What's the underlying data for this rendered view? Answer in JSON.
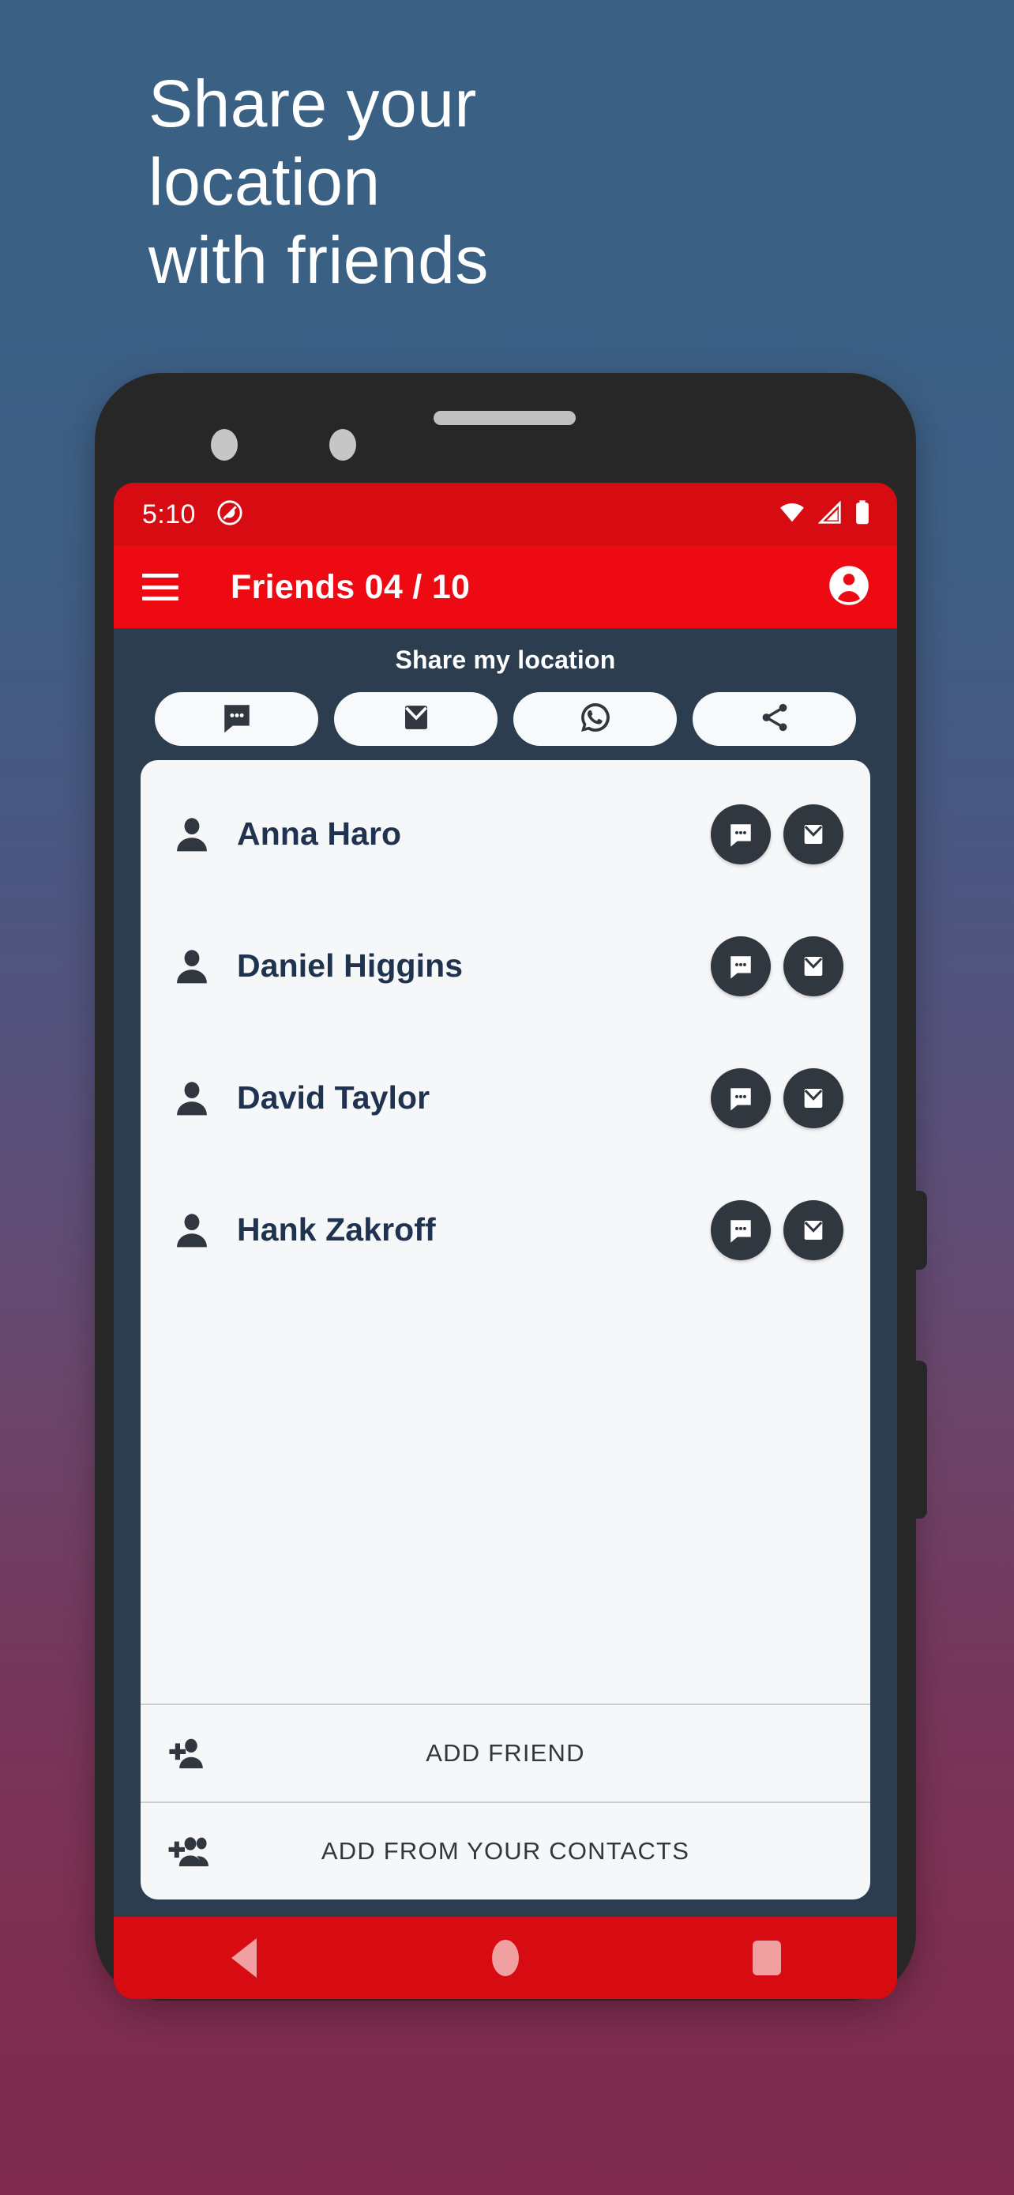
{
  "promo": {
    "headline": "Share your\nlocation\nwith friends"
  },
  "colors": {
    "background_top": "#3a6084",
    "background_bottom": "#7d2a4c",
    "status_bar": "#d70b12",
    "app_bar": "#ee0a13",
    "screen_bg": "#2b3d4f",
    "card_bg": "#f5f7f9",
    "name_text": "#1f3350",
    "circle_button": "#31373f",
    "nav_icon": "#f0a0a0"
  },
  "phone": {
    "status_bar": {
      "time": "5:10",
      "icons": [
        "do-not-disturb-icon",
        "wifi-icon",
        "cell-signal-icon",
        "battery-icon"
      ]
    },
    "app_bar": {
      "menu_icon": "hamburger-menu-icon",
      "title": "Friends  04 / 10",
      "account_icon": "account-circle-icon"
    },
    "share_section": {
      "title": "Share my location",
      "buttons": [
        {
          "name": "share-via-sms",
          "icon": "sms-chat-bubble-icon"
        },
        {
          "name": "share-via-email",
          "icon": "email-envelope-icon"
        },
        {
          "name": "share-via-whatsapp",
          "icon": "whatsapp-icon"
        },
        {
          "name": "share-via-other",
          "icon": "share-nodes-icon"
        }
      ]
    },
    "friends": [
      {
        "name": "Anna Haro"
      },
      {
        "name": "Daniel Higgins"
      },
      {
        "name": "David Taylor"
      },
      {
        "name": "Hank Zakroff"
      }
    ],
    "friend_row_actions": [
      {
        "name": "send-sms",
        "icon": "sms-chat-bubble-icon"
      },
      {
        "name": "send-email",
        "icon": "email-envelope-icon"
      }
    ],
    "card_actions": [
      {
        "label": "ADD FRIEND",
        "icon": "person-add-icon"
      },
      {
        "label": "ADD FROM YOUR CONTACTS",
        "icon": "group-add-icon"
      }
    ],
    "nav_bar": {
      "back": "back-triangle-icon",
      "home": "home-circle-icon",
      "recents": "recents-square-icon"
    }
  }
}
